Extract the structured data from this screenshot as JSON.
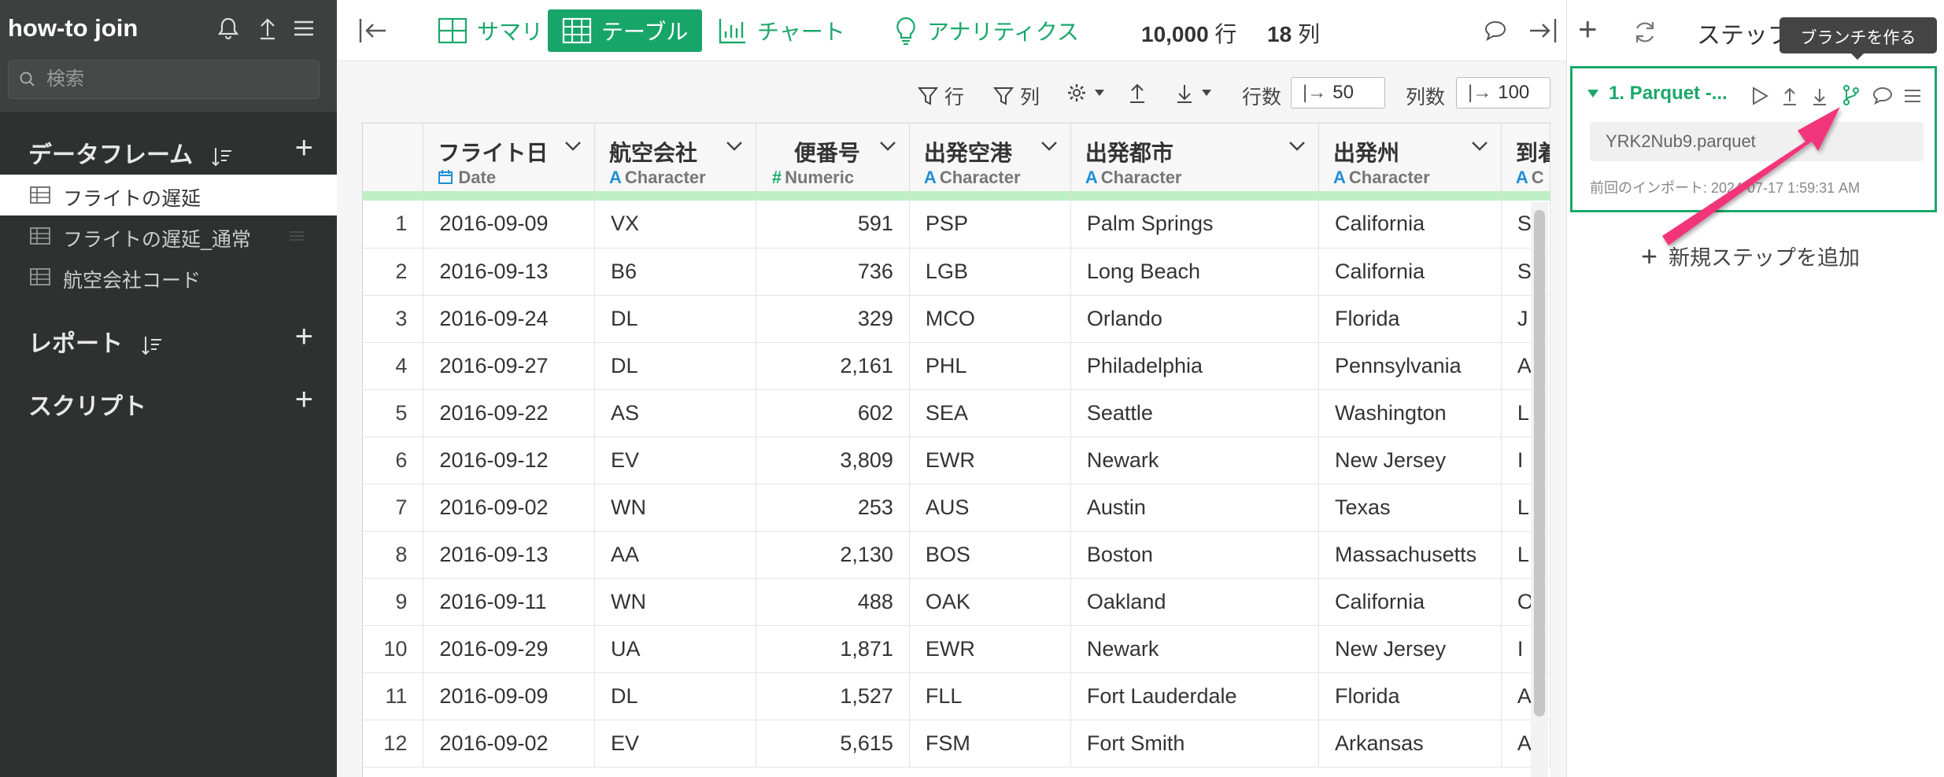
{
  "sidebar": {
    "project_title": "how-to join",
    "search_placeholder": "検索",
    "sections": {
      "dataframes": "データフレーム",
      "reports": "レポート",
      "scripts": "スクリプト"
    },
    "dataframes": [
      {
        "label": "フライトの遅延",
        "active": true
      },
      {
        "label": "フライトの遅延_通常",
        "active": false
      },
      {
        "label": "航空会社コード",
        "active": false
      }
    ]
  },
  "toolbar": {
    "summary": "サマリ",
    "table": "テーブル",
    "chart": "チャート",
    "analytics": "アナリティクス",
    "rows_count": "10,000",
    "rows_unit": "行",
    "cols_count": "18",
    "cols_unit": "列"
  },
  "subtoolbar": {
    "row_filter": "行",
    "col_filter": "列",
    "row_count_label": "行数",
    "row_count_value": "50",
    "col_count_label": "列数",
    "col_count_value": "100"
  },
  "table": {
    "columns": [
      {
        "name": "フライト日",
        "type": "Date"
      },
      {
        "name": "航空会社",
        "type": "Character"
      },
      {
        "name": "便番号",
        "type": "Numeric"
      },
      {
        "name": "出発空港",
        "type": "Character"
      },
      {
        "name": "出発都市",
        "type": "Character"
      },
      {
        "name": "出発州",
        "type": "Character"
      },
      {
        "name": "到着",
        "type": "C"
      }
    ],
    "rows": [
      [
        "1",
        "2016-09-09",
        "VX",
        "591",
        "PSP",
        "Palm Springs",
        "California",
        "S"
      ],
      [
        "2",
        "2016-09-13",
        "B6",
        "736",
        "LGB",
        "Long Beach",
        "California",
        "S"
      ],
      [
        "3",
        "2016-09-24",
        "DL",
        "329",
        "MCO",
        "Orlando",
        "Florida",
        "J"
      ],
      [
        "4",
        "2016-09-27",
        "DL",
        "2,161",
        "PHL",
        "Philadelphia",
        "Pennsylvania",
        "A"
      ],
      [
        "5",
        "2016-09-22",
        "AS",
        "602",
        "SEA",
        "Seattle",
        "Washington",
        "L"
      ],
      [
        "6",
        "2016-09-12",
        "EV",
        "3,809",
        "EWR",
        "Newark",
        "New Jersey",
        "I"
      ],
      [
        "7",
        "2016-09-02",
        "WN",
        "253",
        "AUS",
        "Austin",
        "Texas",
        "L"
      ],
      [
        "8",
        "2016-09-13",
        "AA",
        "2,130",
        "BOS",
        "Boston",
        "Massachusetts",
        "L"
      ],
      [
        "9",
        "2016-09-11",
        "WN",
        "488",
        "OAK",
        "Oakland",
        "California",
        "O"
      ],
      [
        "10",
        "2016-09-29",
        "UA",
        "1,871",
        "EWR",
        "Newark",
        "New Jersey",
        "I"
      ],
      [
        "11",
        "2016-09-09",
        "DL",
        "1,527",
        "FLL",
        "Fort Lauderdale",
        "Florida",
        "A"
      ],
      [
        "12",
        "2016-09-02",
        "EV",
        "5,615",
        "FSM",
        "Fort Smith",
        "Arkansas",
        "A"
      ]
    ]
  },
  "right_panel": {
    "steps_label": "ステップ",
    "tooltip": "ブランチを作る",
    "step_title": "1. Parquet -...",
    "step_file": "YRK2Nub9.parquet",
    "step_meta": "前回のインポート: 2024-07-17 1:59:31 AM",
    "add_step": "新規ステップを追加"
  },
  "colors": {
    "accent": "#18a56a",
    "sidebar_bg": "#2f3030",
    "annotation_arrow": "#f2357a"
  }
}
